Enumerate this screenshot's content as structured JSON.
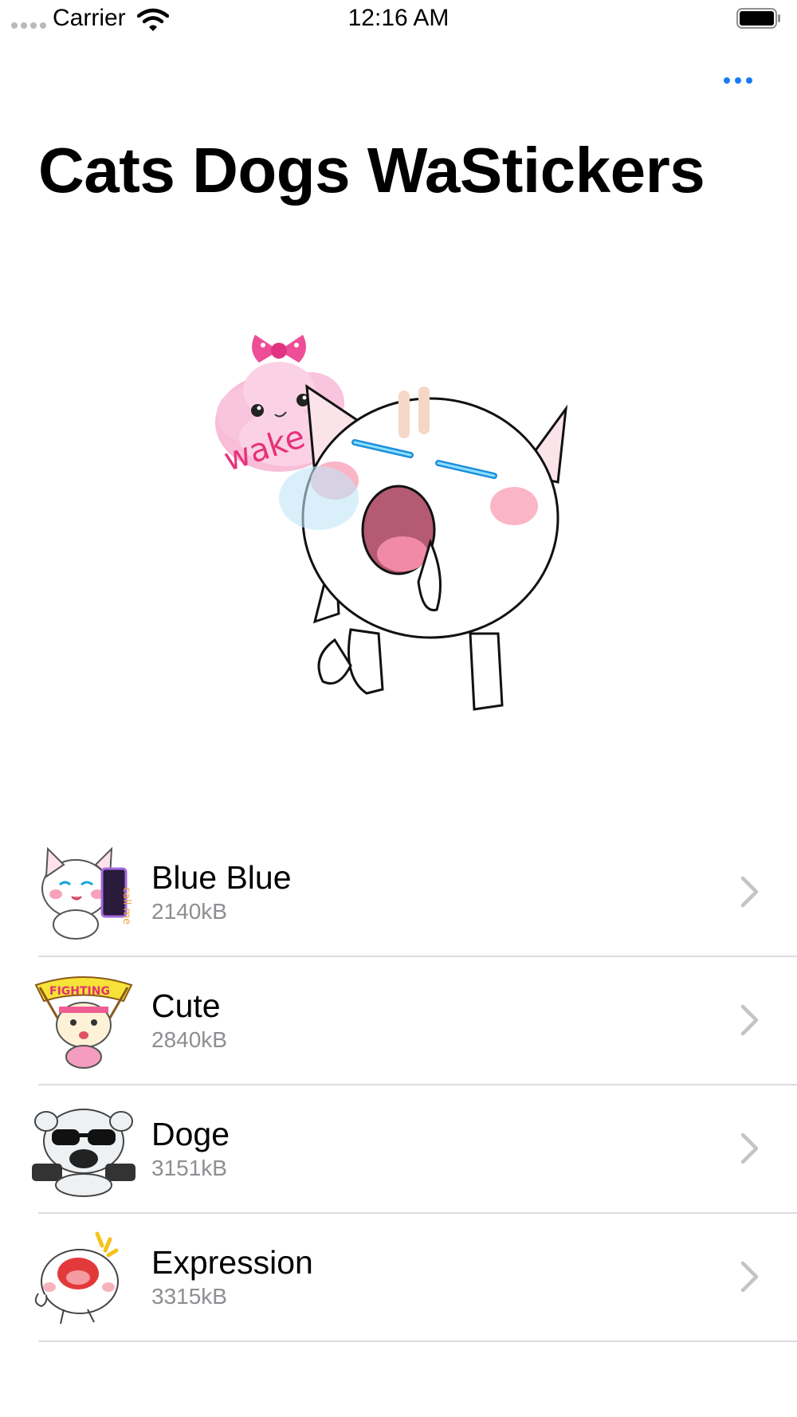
{
  "status_bar": {
    "carrier": "Carrier",
    "time": "12:16 AM"
  },
  "nav": {
    "more_icon": "ellipsis-icon",
    "accent_color": "#1a7cf5"
  },
  "page": {
    "title": "Cats Dogs WaStickers"
  },
  "hero": {
    "bubble_text": "wake up"
  },
  "sticker_packs": [
    {
      "name": "Blue Blue",
      "size": "2140kB",
      "thumb_text": "call me"
    },
    {
      "name": "Cute",
      "size": "2840kB",
      "thumb_text": "FIGHTING"
    },
    {
      "name": "Doge",
      "size": "3151kB"
    },
    {
      "name": "Expression",
      "size": "3315kB"
    }
  ]
}
